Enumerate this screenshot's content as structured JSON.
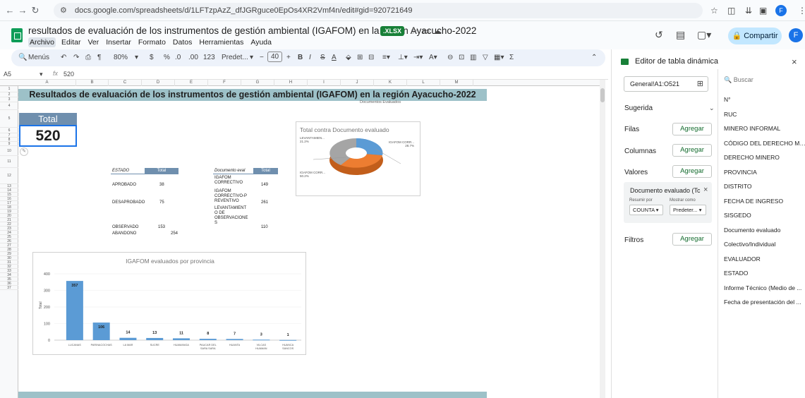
{
  "browser": {
    "url": "docs.google.com/spreadsheets/d/1LFTzpAzZ_dfJGRguce0EpOs4XR2Vmf4n/edit#gid=920721649",
    "avatar": "F"
  },
  "doc": {
    "title": "resultados de evaluación de los instrumentos de gestión ambiental (IGAFOM) en la región Ayacucho-2022",
    "badge": ".XLSX",
    "menus": [
      "Archivo",
      "Editar",
      "Ver",
      "Insertar",
      "Formato",
      "Datos",
      "Herramientas",
      "Ayuda"
    ],
    "share_label": "Compartir",
    "avatar": "F"
  },
  "toolbar": {
    "menus": "Menús",
    "zoom": "80%",
    "currency": "$",
    "percent": "%",
    "dec_minus": ".0",
    "dec_plus": ".00",
    "numfmt": "123",
    "font": "Predet...",
    "font_size": "40",
    "bold": "B",
    "italic": "I",
    "strike": "S",
    "textcolor": "A"
  },
  "formula_bar": {
    "cell_ref": "A5",
    "fx": "fx",
    "value": "520"
  },
  "grid": {
    "columns": [
      "A",
      "B",
      "C",
      "D",
      "E",
      "F",
      "G",
      "H",
      "I",
      "J",
      "K",
      "L",
      "M"
    ],
    "rows": [
      "1",
      "2",
      "3",
      "4",
      "5",
      "6",
      "7",
      "8",
      "9",
      "10",
      "11",
      "12",
      "13",
      "14",
      "15",
      "16",
      "17",
      "18",
      "19",
      "20",
      "21",
      "22",
      "23",
      "24",
      "25",
      "26",
      "27",
      "28",
      "29",
      "30",
      "31",
      "32",
      "33",
      "34",
      "35",
      "36",
      "37"
    ],
    "banner": "Resultados de evaluación de los instrumentos de gestión ambiental (IGAFOM) en la región Ayacucho-2022",
    "total_label": "Total",
    "total_value": "520",
    "doc_eval_note": "Documentos Evaluados"
  },
  "estado_table": {
    "h1": "ESTADO",
    "h2": "Total",
    "rows": [
      {
        "k": "APROBADO",
        "v": "38"
      },
      {
        "k": "DESAPROBADO",
        "v": "75"
      },
      {
        "k": "OBSERVADO",
        "v": "153"
      },
      {
        "k": "ABANDONO",
        "v": "254"
      }
    ]
  },
  "doc_table": {
    "h1": "Documento eval",
    "h2": "Total",
    "rows": [
      {
        "k": "IGAFOM CORRECTIVO",
        "v": "149"
      },
      {
        "k": "IGAFOM CORRECTIVO-P REVENTIVO",
        "v": "261"
      },
      {
        "k": "LEVANTAMIENT O DE OBSERVACIONE S",
        "v": "110"
      }
    ]
  },
  "pie": {
    "title": "Total contra Documento evaluado",
    "labels": [
      {
        "name": "LEVANTAMIEN...",
        "pct": "21.2%"
      },
      {
        "name": "IGAFOM CORR...",
        "pct": "28.7%"
      },
      {
        "name": "IGAFOM CORR...",
        "pct": "50.2%"
      }
    ]
  },
  "chart_data": {
    "type": "bar",
    "title": "IGAFOM evaluados por provincia",
    "ylabel": "Total",
    "xlabel": "",
    "categories": [
      "LUCANAS",
      "PARINACOCHAS",
      "LA MAR",
      "SUCRE",
      "HUAMANGA",
      "PAUCAR DEL SARA SARA",
      "HUANTA",
      "VILCAS HUAMAN",
      "HUANCA SANCOS"
    ],
    "values": [
      357,
      106,
      14,
      13,
      11,
      8,
      7,
      3,
      1
    ],
    "ylim": [
      0,
      400
    ],
    "yticks": [
      "0",
      "100",
      "200",
      "300",
      "400"
    ],
    "color": "#5b9bd5"
  },
  "panel": {
    "title": "Editor de tabla dinámica",
    "range": "General!A1:O521",
    "suggested": "Sugerida",
    "rows_label": "Filas",
    "cols_label": "Columnas",
    "values_label": "Valores",
    "filters_label": "Filtros",
    "add": "Agregar",
    "value_field": "Documento evaluado (Tc",
    "summarize_label": "Resumir por",
    "summarize_value": "COUNTA",
    "show_as_label": "Mostrar como",
    "show_as_value": "Predeter...",
    "search_placeholder": "Buscar",
    "fields": [
      "N°",
      "RUC",
      "MINERO INFORMAL",
      "CÓDIGO DEL DERECHO MI...",
      "DERECHO MINERO",
      "PROVINCIA",
      "DISTRITO",
      "FECHA DE INGRESO",
      "SISGEDO",
      "Documento evaluado",
      "Colectivo/Individual",
      "EVALUADOR",
      "ESTADO",
      "Informe Técnico (Medio de ...",
      "Fecha de presentación del ..."
    ]
  }
}
